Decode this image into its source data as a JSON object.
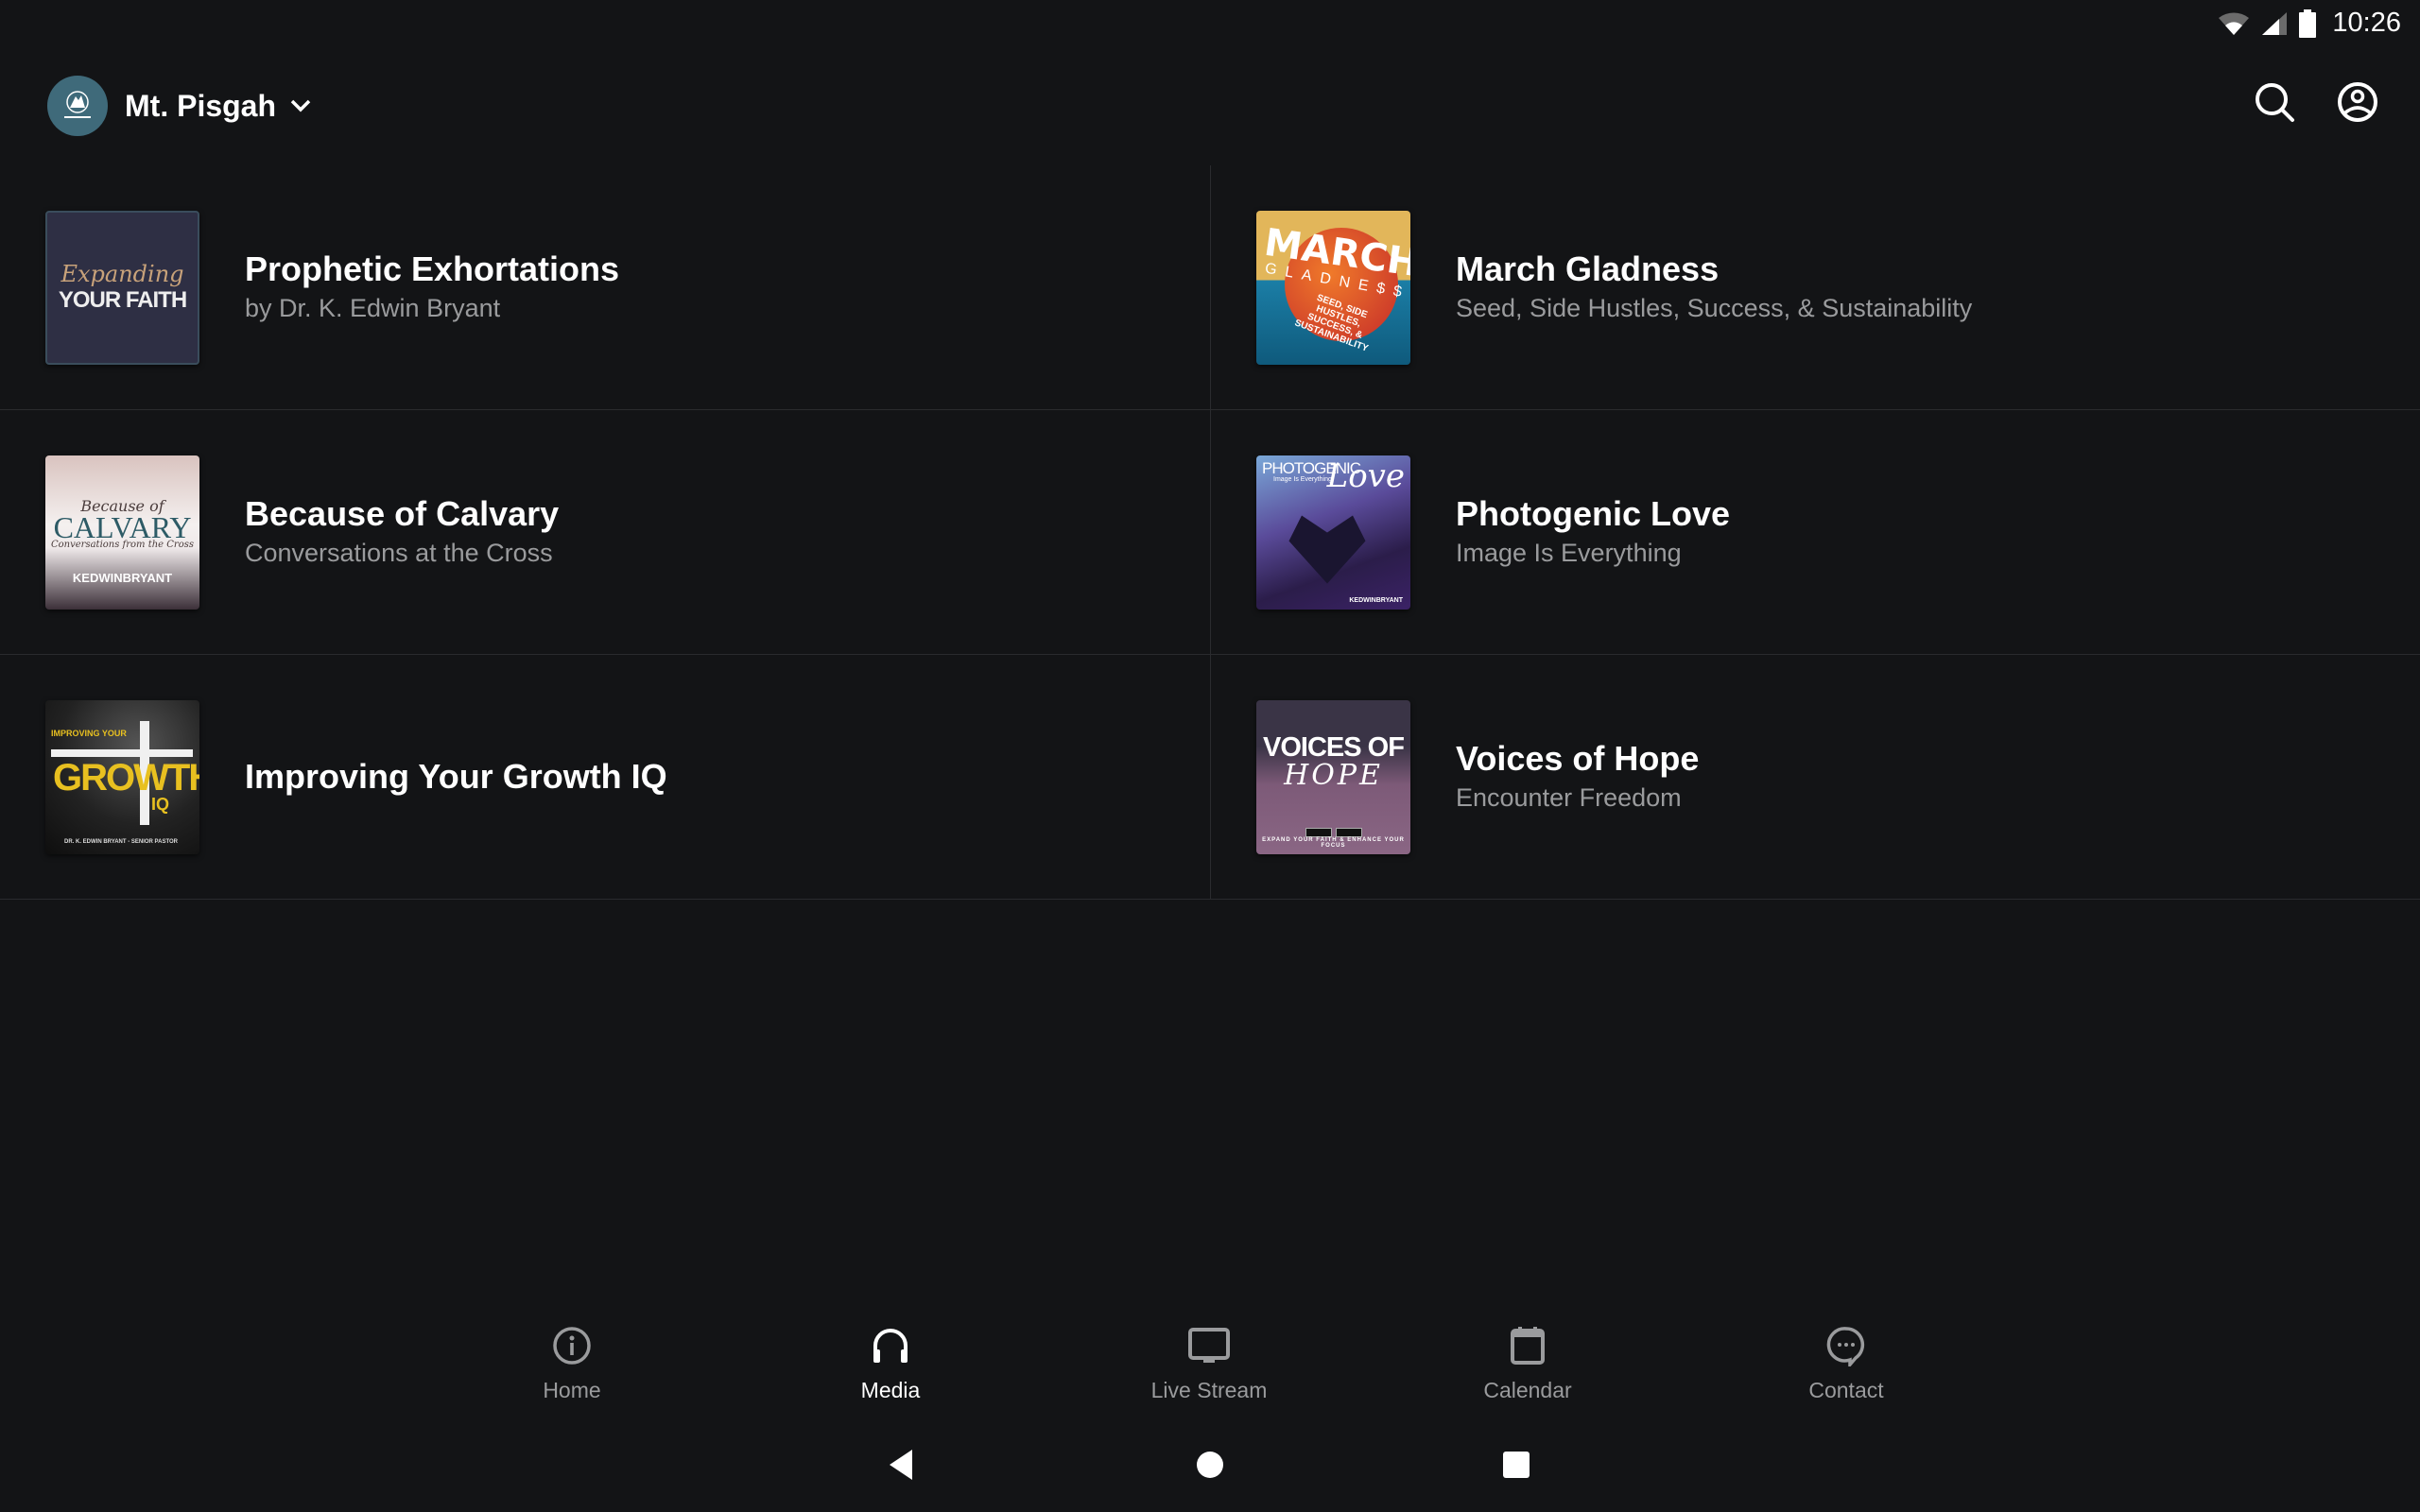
{
  "status_bar": {
    "time": "10:26",
    "icons": [
      "wifi-icon",
      "cell-signal-icon",
      "battery-icon"
    ]
  },
  "header": {
    "church_name": "Mt. Pisgah",
    "avatar_icon": "church-logo",
    "dropdown_icon": "chevron-down-icon",
    "actions": [
      {
        "name": "search",
        "icon": "search-icon"
      },
      {
        "name": "profile",
        "icon": "account-circle-icon"
      }
    ]
  },
  "series": [
    {
      "title": "Prophetic Exhortations",
      "subtitle": "by Dr. K. Edwin Bryant",
      "artwork": {
        "line1": "Expanding",
        "line2": "YOUR FAITH"
      }
    },
    {
      "title": "March Gladness",
      "subtitle": "Seed, Side Hustles, Success, & Sustainability",
      "artwork": {
        "line1": "MARCH",
        "line2": "GLADNE$$",
        "line3": "SEED, SIDE HUSTLES, SUCCESS, & SUSTAINABILITY"
      }
    },
    {
      "title": "Because of Calvary",
      "subtitle": "Conversations at the Cross",
      "artwork": {
        "line1": "Because of",
        "line2": "CALVARY",
        "line3": "Conversations from the Cross",
        "line4": "KEDWINBRYANT"
      }
    },
    {
      "title": "Photogenic Love",
      "subtitle": "Image Is Everything",
      "artwork": {
        "line1": "PHOTOGENIC",
        "line2": "Image Is Everything",
        "line3": "Love",
        "line4": "KEDWINBRYANT"
      }
    },
    {
      "title": "Improving Your Growth IQ",
      "subtitle": "",
      "artwork": {
        "line1": "IMPROVING YOUR",
        "line2": "GROWTH",
        "line3": "IQ",
        "line4": "DR. K. EDWIN BRYANT - SENIOR PASTOR"
      }
    },
    {
      "title": "Voices of Hope",
      "subtitle": "Encounter Freedom",
      "artwork": {
        "line1": "VOICES OF",
        "line2": "HOPE",
        "line3": "EXPAND YOUR FAITH & ENHANCE YOUR FOCUS"
      }
    }
  ],
  "bottom_nav": {
    "active": "Media",
    "items": [
      {
        "label": "Home",
        "icon": "info-icon"
      },
      {
        "label": "Media",
        "icon": "headphones-icon"
      },
      {
        "label": "Live Stream",
        "icon": "monitor-icon"
      },
      {
        "label": "Calendar",
        "icon": "calendar-icon"
      },
      {
        "label": "Contact",
        "icon": "chat-bubble-icon"
      }
    ]
  },
  "system_nav": [
    "back",
    "home",
    "recents"
  ],
  "colors": {
    "background": "#131416",
    "divider": "#2a2b2e",
    "text_primary": "#ffffff",
    "text_secondary": "#9a9b9d",
    "avatar": "#3f6a7a"
  }
}
